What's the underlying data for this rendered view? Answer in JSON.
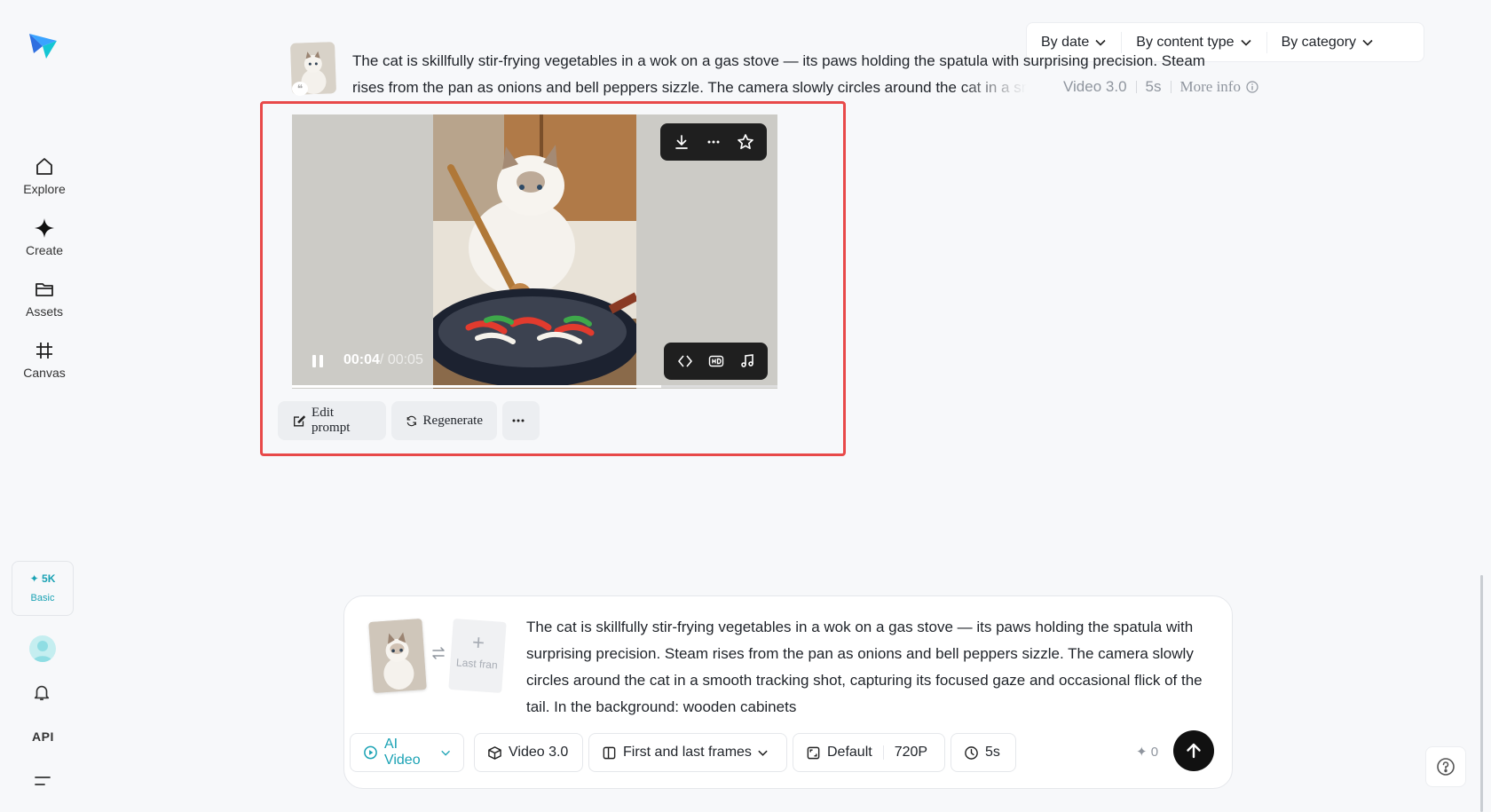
{
  "sidebar": {
    "items": [
      {
        "label": "Explore",
        "icon": "home-icon"
      },
      {
        "label": "Create",
        "icon": "sparkle-icon"
      },
      {
        "label": "Assets",
        "icon": "folder-icon"
      },
      {
        "label": "Canvas",
        "icon": "canvas-icon"
      }
    ],
    "credits": {
      "amount": "5K",
      "plan": "Basic"
    },
    "api_label": "API"
  },
  "filters": {
    "date": "By date",
    "content_type": "By content type",
    "category": "By category"
  },
  "history": {
    "prompt_line1": "The cat is skillfully stir-frying vegetables in a wok on a gas stove — its paws holding the spatula with surprising precision. Steam",
    "prompt_line2": "rises from the pan as onions and bell peppers sizzle. The camera slowly circles around the cat in a smooth",
    "model": "Video 3.0",
    "duration": "5s",
    "more_info": "More info"
  },
  "player": {
    "current_time": "00:04",
    "total_time": "/ 00:05",
    "progress": 0.76
  },
  "actions": {
    "edit_prompt": "Edit prompt",
    "regenerate": "Regenerate"
  },
  "composer": {
    "last_frame_label": "Last fran",
    "prompt": "The cat is skillfully stir-frying vegetables in a wok on a gas stove — its paws holding the spatula with surprising precision. Steam rises from the pan as onions and bell peppers sizzle. The camera slowly circles around the cat in a smooth tracking shot, capturing its focused gaze and occasional flick of the tail. In the background: wooden cabinets",
    "mode": "AI Video",
    "model": "Video 3.0",
    "frame_mode": "First and last frames",
    "ratio": "Default",
    "resolution": "720P",
    "duration": "5s",
    "cost": "0"
  },
  "colors": {
    "accent": "#1aa2b4",
    "highlight": "#e84949"
  }
}
